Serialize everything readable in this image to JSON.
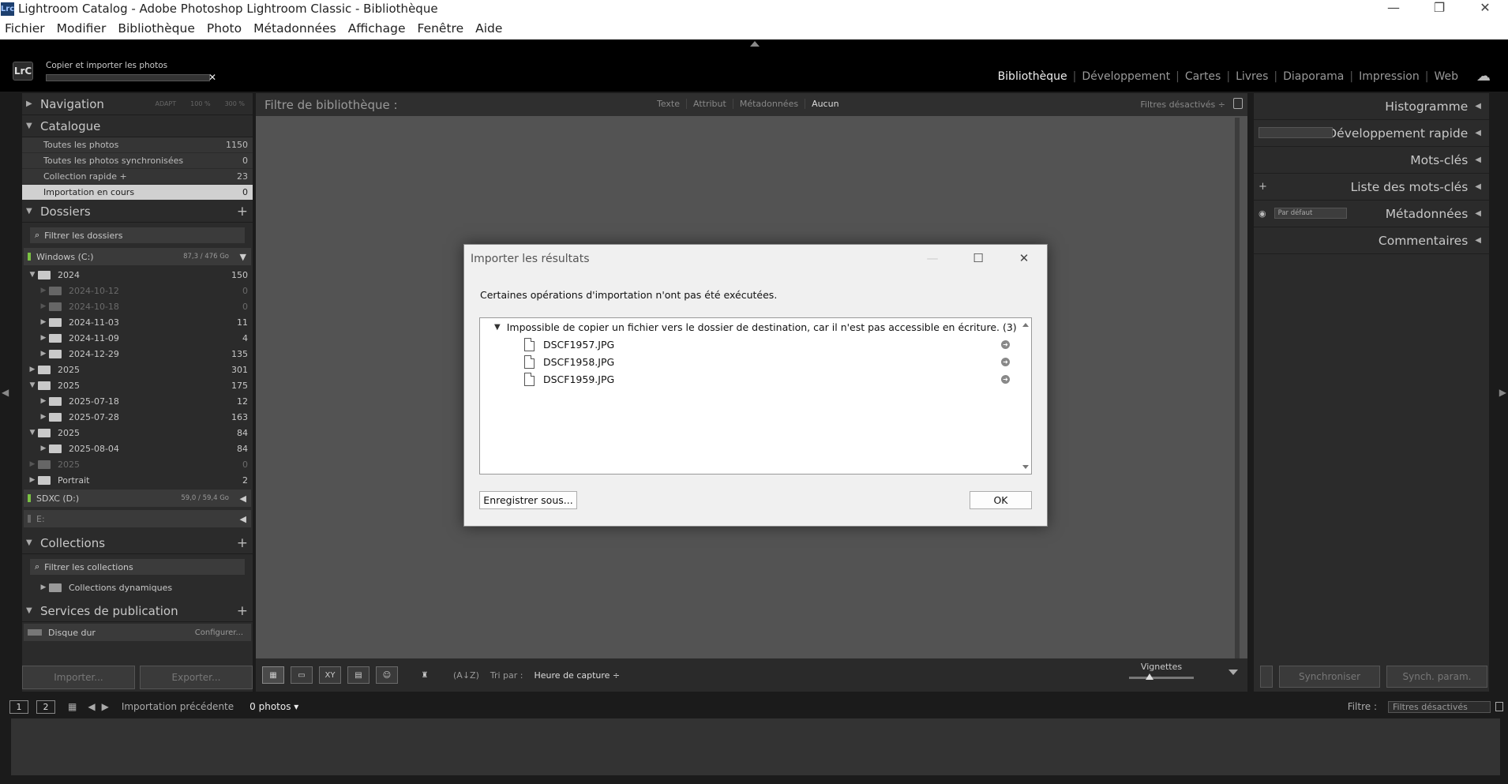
{
  "window": {
    "title": "Lightroom Catalog - Adobe Photoshop Lightroom Classic - Bibliothèque",
    "app_badge": "Lrc",
    "controls": [
      "—",
      "❐",
      "✕"
    ]
  },
  "menu": [
    "Fichier",
    "Modifier",
    "Bibliothèque",
    "Photo",
    "Métadonnées",
    "Affichage",
    "Fenêtre",
    "Aide"
  ],
  "header": {
    "logo": "LrC",
    "import_status": "Copier et importer les photos",
    "modules": [
      "Bibliothèque",
      "Développement",
      "Cartes",
      "Livres",
      "Diaporama",
      "Impression",
      "Web"
    ],
    "active_module": "Bibliothèque"
  },
  "left": {
    "navigation": {
      "title": "Navigation",
      "opts": [
        "ADAPT",
        "100 %",
        "300 %"
      ]
    },
    "catalogue": {
      "title": "Catalogue",
      "items": [
        {
          "label": "Toutes les photos",
          "count": "1150"
        },
        {
          "label": "Toutes les photos synchronisées",
          "count": "0"
        },
        {
          "label": "Collection rapide +",
          "count": "23"
        },
        {
          "label": "Importation en cours",
          "count": "0"
        }
      ]
    },
    "dossiers": {
      "title": "Dossiers",
      "filter_placeholder": "Filtrer les dossiers",
      "volume_c": {
        "label": "Windows (C:)",
        "capacity": "87,3 / 476 Go"
      },
      "folders": [
        {
          "label": "2024",
          "count": "150",
          "level": 0,
          "tri": "▼",
          "dim": false
        },
        {
          "label": "2024-10-12",
          "count": "0",
          "level": 1,
          "tri": "▶",
          "dim": true
        },
        {
          "label": "2024-10-18",
          "count": "0",
          "level": 1,
          "tri": "▶",
          "dim": true
        },
        {
          "label": "2024-11-03",
          "count": "11",
          "level": 1,
          "tri": "▶",
          "dim": false
        },
        {
          "label": "2024-11-09",
          "count": "4",
          "level": 1,
          "tri": "▶",
          "dim": false
        },
        {
          "label": "2024-12-29",
          "count": "135",
          "level": 1,
          "tri": "▶",
          "dim": false
        },
        {
          "label": "2025",
          "count": "301",
          "level": 0,
          "tri": "▶",
          "dim": false
        },
        {
          "label": "2025",
          "count": "175",
          "level": 0,
          "tri": "▼",
          "dim": false
        },
        {
          "label": "2025-07-18",
          "count": "12",
          "level": 1,
          "tri": "▶",
          "dim": false
        },
        {
          "label": "2025-07-28",
          "count": "163",
          "level": 1,
          "tri": "▶",
          "dim": false
        },
        {
          "label": "2025",
          "count": "84",
          "level": 0,
          "tri": "▼",
          "dim": false
        },
        {
          "label": "2025-08-04",
          "count": "84",
          "level": 1,
          "tri": "▶",
          "dim": false
        },
        {
          "label": "2025",
          "count": "0",
          "level": 0,
          "tri": "▶",
          "dim": true
        },
        {
          "label": "Portrait",
          "count": "2",
          "level": 0,
          "tri": "▶",
          "dim": false
        }
      ],
      "volume_d": {
        "label": "SDXC (D:)",
        "capacity": "59,0 / 59,4 Go"
      },
      "volume_e": {
        "label": "E:"
      }
    },
    "collections": {
      "title": "Collections",
      "filter_placeholder": "Filtrer les collections",
      "item": "Collections dynamiques"
    },
    "publish": {
      "title": "Services de publication",
      "item": "Disque dur",
      "configure": "Configurer..."
    },
    "import_btn": "Importer...",
    "export_btn": "Exporter..."
  },
  "center": {
    "filter_title": "Filtre de bibliothèque :",
    "filter_tabs": [
      "Texte",
      "Attribut",
      "Métadonnées",
      "Aucun"
    ],
    "filters_off": "Filtres désactivés ÷",
    "sort_label": "Tri par :",
    "sort_value": "Heure de capture ÷",
    "thumbs_label": "Vignettes",
    "thumbnail_size_fraction": 0.32
  },
  "right": {
    "histogram": "Histogramme",
    "quick_dev": "Développement rapide",
    "keywords": "Mots-clés",
    "keyword_list": "Liste des mots-clés",
    "metadata": "Métadonnées",
    "metadata_preset": "Par défaut",
    "comments": "Commentaires",
    "sync_btn": "Synchroniser",
    "sync_settings_btn": "Synch. param."
  },
  "filmbar": {
    "screens": [
      "1",
      "2"
    ],
    "prev_import": "Importation précédente",
    "photos": "0 photos ▾",
    "filter_label": "Filtre :",
    "filter_value": "Filtres désactivés"
  },
  "dialog": {
    "title": "Importer les résultats",
    "message": "Certaines opérations d'importation n'ont pas été exécutées.",
    "error_header": "Impossible de copier un fichier vers le dossier de destination, car il n'est pas accessible en écriture. (3)",
    "files": [
      "DSCF1957.JPG",
      "DSCF1958.JPG",
      "DSCF1959.JPG"
    ],
    "save_btn": "Enregistrer sous...",
    "ok_btn": "OK"
  }
}
